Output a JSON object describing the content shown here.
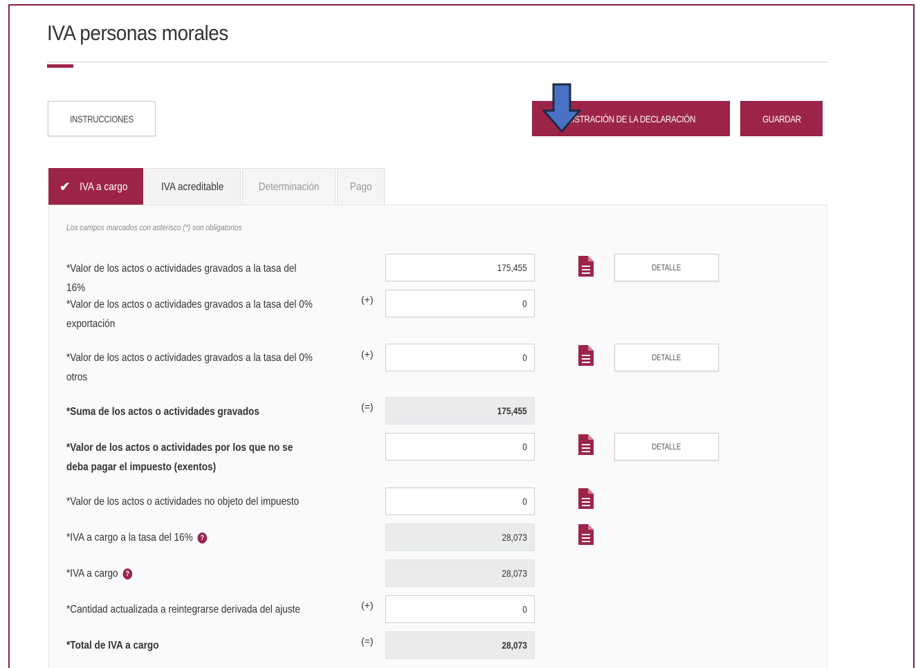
{
  "page": {
    "title": "IVA personas morales",
    "colors": {
      "accent": "#9d2449",
      "readonly_bg": "#e9ebed"
    }
  },
  "toolbar": {
    "instructions_label": "INSTRUCCIONES",
    "admin_label": "ADMINISTRACIÓN DE LA DECLARACIÓN",
    "admin_visible_label": "NISTRACIÓN DE LA DECLARACIÓN",
    "save_label": "GUARDAR"
  },
  "tabs": [
    {
      "label": "IVA a cargo",
      "state": "active",
      "icon": "check-icon"
    },
    {
      "label": "IVA acreditable",
      "state": "enabled"
    },
    {
      "label": "Determinación",
      "state": "disabled"
    },
    {
      "label": "Pago",
      "state": "disabled"
    }
  ],
  "form": {
    "required_note": "Los campos marcados con asterisco (*) son obligatorios",
    "detail_label": "DETALLE",
    "rows": [
      {
        "label": "*Valor de los actos o actividades gravados a la tasa del 16%",
        "operator": "",
        "value": "175,455",
        "readonly": false,
        "doc_icon": true,
        "detail": true
      },
      {
        "label": "*Valor de los actos o actividades gravados a la tasa del 0% exportación",
        "operator": "(+)",
        "value": "0",
        "readonly": false,
        "doc_icon": false,
        "detail": false
      },
      {
        "label": "*Valor de los actos o actividades gravados a la tasa del 0% otros",
        "operator": "(+)",
        "value": "0",
        "readonly": false,
        "doc_icon": true,
        "detail": true
      },
      {
        "label": "*Suma de los actos o actividades gravados",
        "operator": "(=)",
        "value": "175,455",
        "readonly": true,
        "bold": true
      },
      {
        "label": "*Valor de los actos o actividades por los que no se deba pagar el impuesto (exentos)",
        "operator": "",
        "value": "0",
        "readonly": false,
        "doc_icon": true,
        "detail": true
      },
      {
        "label": "*Valor de los actos o actividades no objeto del impuesto",
        "operator": "",
        "value": "0",
        "readonly": false,
        "doc_icon": true
      },
      {
        "label": "*IVA a cargo a la tasa del 16%",
        "operator": "",
        "value": "28,073",
        "readonly": true,
        "doc_icon": true,
        "help": true
      },
      {
        "label": "*IVA a cargo",
        "operator": "",
        "value": "28,073",
        "readonly": true,
        "help": true
      },
      {
        "label": "*Cantidad actualizada a reintegrarse derivada del ajuste",
        "operator": "(+)",
        "value": "0",
        "readonly": false
      },
      {
        "label": "*Total de IVA a cargo",
        "operator": "(=)",
        "value": "28,073",
        "readonly": true,
        "bold": true
      }
    ]
  }
}
